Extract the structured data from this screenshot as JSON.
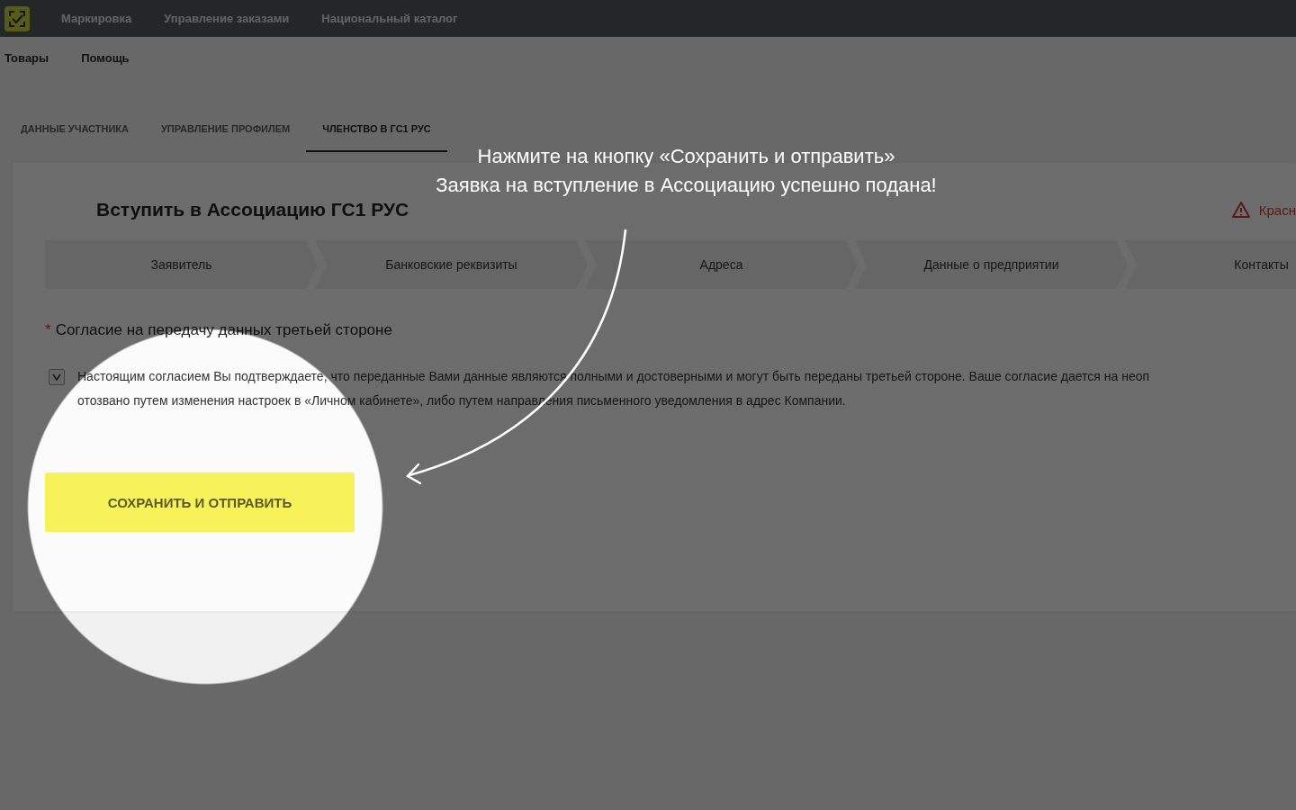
{
  "top_nav": [
    {
      "label": "Маркировка"
    },
    {
      "label": "Управление заказами"
    },
    {
      "label": "Национальный каталог"
    }
  ],
  "sub_nav": [
    {
      "label": "Товары"
    },
    {
      "label": "Помощь"
    }
  ],
  "tabs": [
    {
      "label": "ДАННЫЕ УЧАСТНИКА",
      "selected": false
    },
    {
      "label": "УПРАВЛЕНИЕ ПРОФИЛЕМ",
      "selected": false
    },
    {
      "label": "ЧЛЕНСТВО В ГС1 РУС",
      "selected": true
    }
  ],
  "page_title": "Вступить в Ассоциацию ГС1 РУС",
  "warning": "Красн",
  "steps": [
    {
      "label": "Заявитель"
    },
    {
      "label": "Банковские реквизиты"
    },
    {
      "label": "Адреса"
    },
    {
      "label": "Данные о предприятии"
    },
    {
      "label": "Контакты"
    }
  ],
  "consent": {
    "required_mark": "*",
    "label": "Согласие на передачу данных третьей стороне",
    "checked": true,
    "lines": [
      "Настоящим согласием Вы подтверждаете, что переданные Вами данные являются полными и достоверными и могут быть переданы третьей стороне. Ваше согласие дается на неоп",
      "отозвано путем изменения настроек в «Личном кабинете», либо путем направления письменного уведомления в адрес Компании."
    ]
  },
  "submit_button": "СОХРАНИТЬ И ОТПРАВИТЬ",
  "hint": [
    "Нажмите на кнопку «Сохранить и отправить»",
    "Заявка на вступление в Ассоциацию успешно подана!"
  ]
}
